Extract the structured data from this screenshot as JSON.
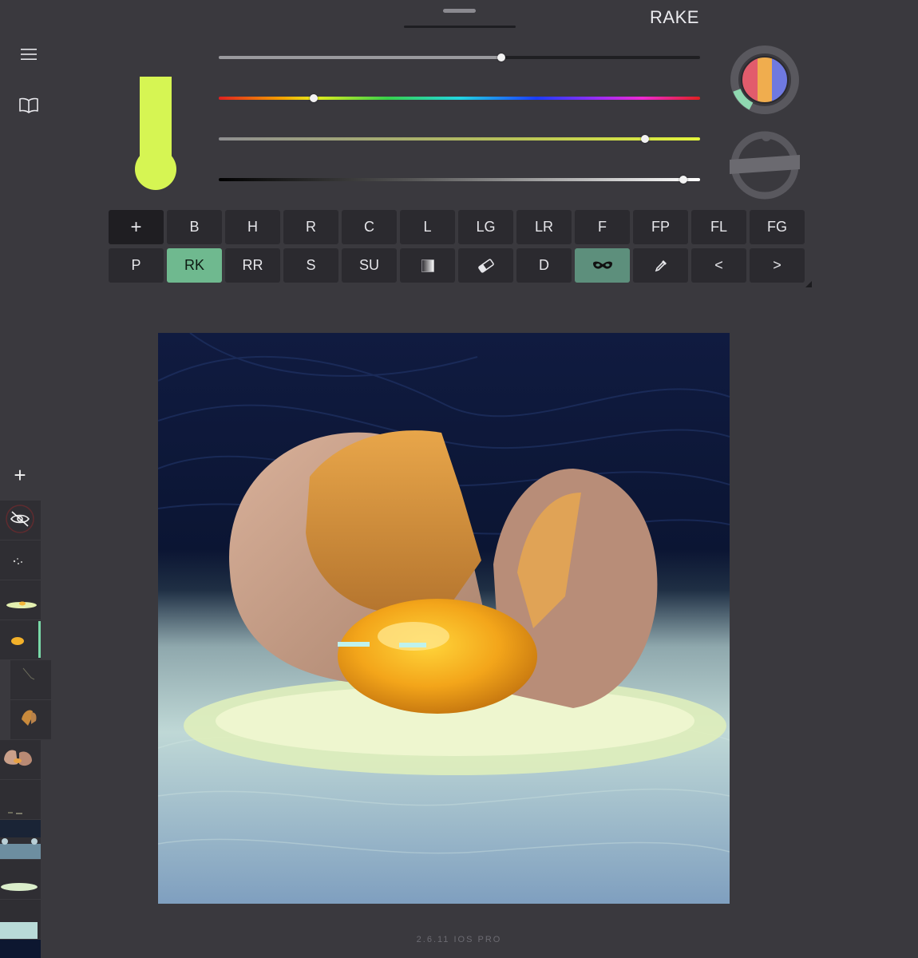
{
  "header": {
    "tool_name": "RAKE"
  },
  "sidebar": [
    {
      "icon": "menu-icon"
    },
    {
      "icon": "book-icon"
    }
  ],
  "color": {
    "current": "#d6f553",
    "sliders": [
      {
        "name": "opacity",
        "value": 0.587
      },
      {
        "name": "hue",
        "value": 0.197
      },
      {
        "name": "saturation",
        "value": 0.886
      },
      {
        "name": "brightness",
        "value": 0.965
      }
    ],
    "palette_colors": [
      "#e25c6c",
      "#f0ad4e",
      "#6f79e0"
    ],
    "palette_accent": "#8fd8b0"
  },
  "tools": {
    "row1": [
      {
        "label": "+",
        "kind": "plus"
      },
      {
        "label": "B"
      },
      {
        "label": "H"
      },
      {
        "label": "R"
      },
      {
        "label": "C"
      },
      {
        "label": "L"
      },
      {
        "label": "LG"
      },
      {
        "label": "LR"
      },
      {
        "label": "F"
      },
      {
        "label": "FP"
      },
      {
        "label": "FL"
      },
      {
        "label": "FG"
      }
    ],
    "row2": [
      {
        "label": "P"
      },
      {
        "label": "RK",
        "active": true
      },
      {
        "label": "RR"
      },
      {
        "label": "S"
      },
      {
        "label": "SU"
      },
      {
        "icon": "gradient-icon"
      },
      {
        "icon": "eraser-icon"
      },
      {
        "label": "D"
      },
      {
        "icon": "mask-icon",
        "active": true
      },
      {
        "icon": "eyedropper-icon"
      },
      {
        "label": "<"
      },
      {
        "label": ">"
      }
    ]
  },
  "layers": {
    "add_label": "+",
    "items": [
      {
        "type": "hidden",
        "icon": "eye-slash-icon"
      },
      {
        "type": "thumb"
      },
      {
        "type": "thumb"
      },
      {
        "type": "thumb",
        "selected": true
      },
      {
        "type": "thumb",
        "indent": true
      },
      {
        "type": "thumb",
        "indent": true
      },
      {
        "type": "thumb"
      },
      {
        "type": "thumb"
      },
      {
        "type": "thumb"
      },
      {
        "type": "thumb"
      },
      {
        "type": "thumb"
      },
      {
        "type": "thumb"
      }
    ]
  },
  "footer": {
    "version": "2.6.11 IOS PRO"
  }
}
